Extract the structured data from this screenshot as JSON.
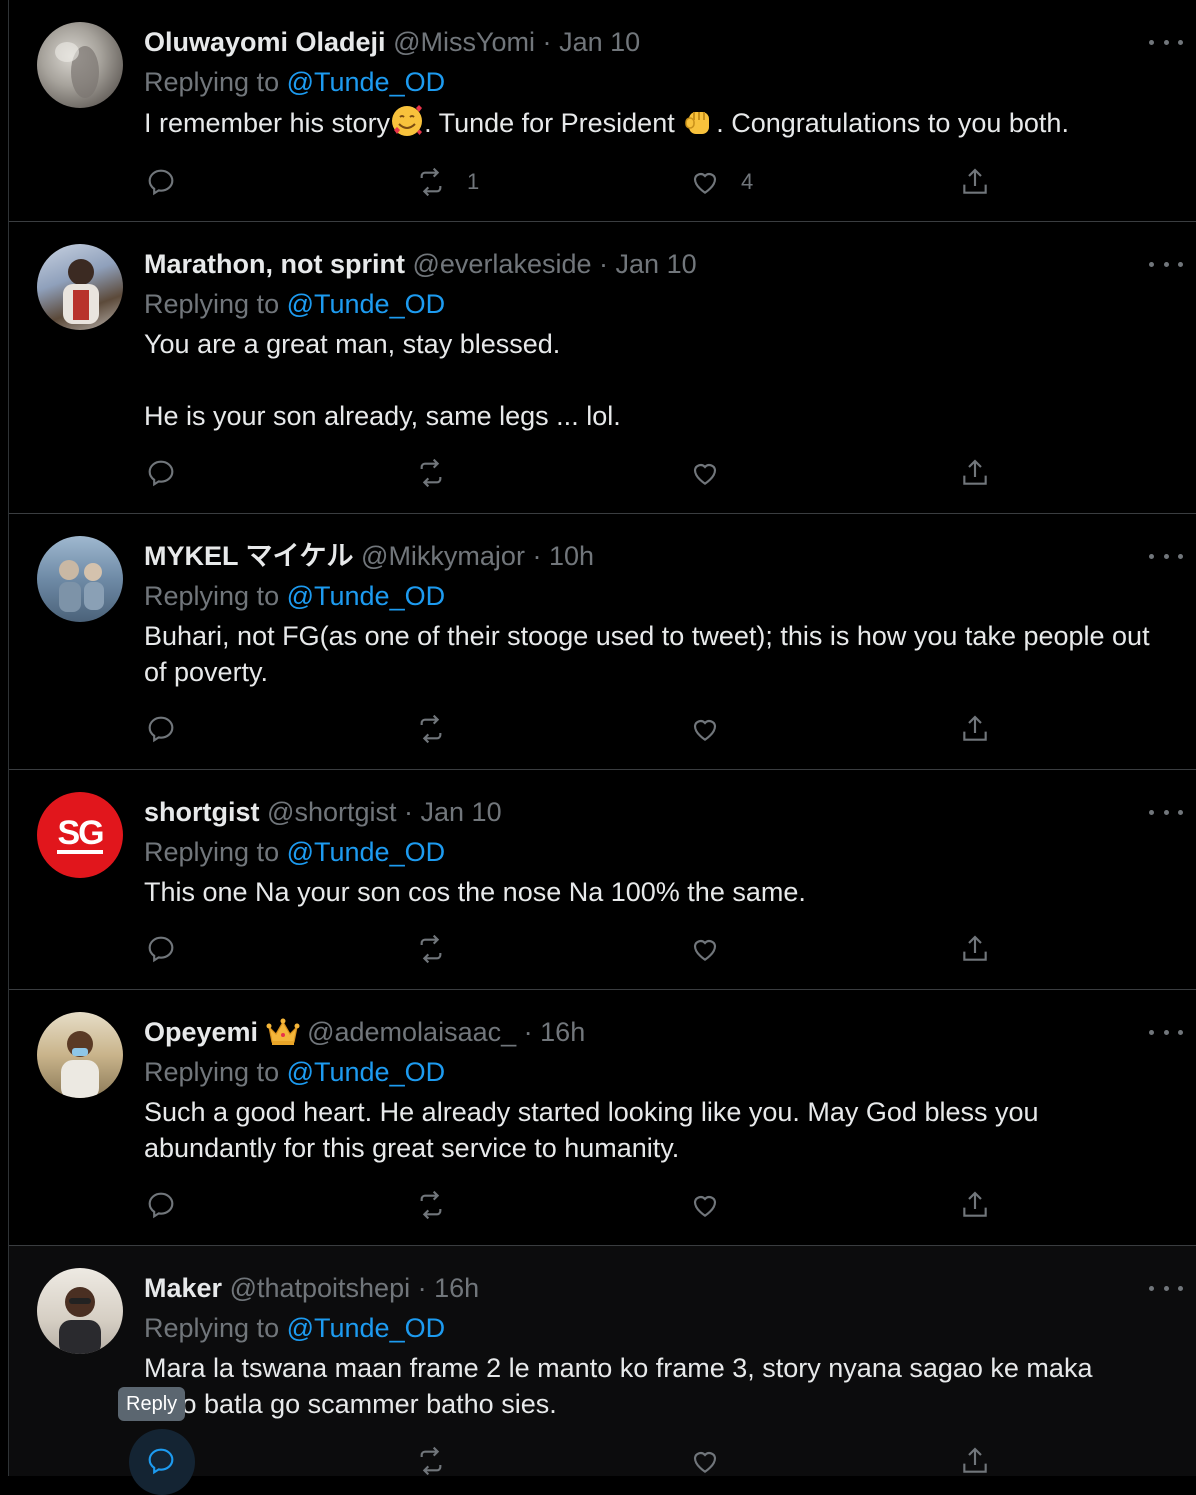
{
  "tweets": [
    {
      "name": "Oluwayomi Oladeji",
      "handle": "@MissYomi",
      "time": "Jan 10",
      "replying_label": "Replying to",
      "replying_to": "@Tunde_OD",
      "text_parts": [
        "I remember his story",
        ". Tunde for President ",
        ". Congratulations to you both."
      ],
      "emoji_icons": [
        "smiling-face-with-hearts-icon",
        "raised-fist-icon"
      ],
      "retweets": "1",
      "likes": "4"
    },
    {
      "name": "Marathon, not sprint",
      "handle": "@everlakeside",
      "time": "Jan 10",
      "replying_label": "Replying to",
      "replying_to": "@Tunde_OD",
      "text": "You are a great man, stay blessed.\n\nHe is your son already, same legs ... lol."
    },
    {
      "name": "MYKEL マイケル",
      "handle": "@Mikkymajor",
      "time": "10h",
      "replying_label": "Replying to",
      "replying_to": "@Tunde_OD",
      "text": "Buhari, not FG(as one of their stooge used to tweet); this is how you take people out of poverty."
    },
    {
      "name": "shortgist",
      "handle": "@shortgist",
      "time": "Jan 10",
      "replying_label": "Replying to",
      "replying_to": "@Tunde_OD",
      "text": "This one Na your son cos the nose Na 100% the same.",
      "avatar_text": "SG"
    },
    {
      "name": "Opeyemi",
      "name_icon": "crown-icon",
      "handle": "@ademolaisaac_",
      "time": "16h",
      "replying_label": "Replying to",
      "replying_to": "@Tunde_OD",
      "text": "Such a good heart. He already started looking like you. May God bless you abundantly for this great service to humanity."
    },
    {
      "name": "Maker",
      "handle": "@thatpoitshepi",
      "time": "16h",
      "replying_label": "Replying to",
      "replying_to": "@Tunde_OD",
      "text": "Mara la tswana maan frame 2 le manto ko frame 3, story nyana sagao ke maka\n     o batla go scammer batho sies."
    }
  ],
  "separator": "·",
  "tooltip": "Reply",
  "colors": {
    "background": "#000000",
    "text": "#e7e9ea",
    "muted": "#71767b",
    "accent": "#1d9bf0",
    "divider": "#3a3d40"
  }
}
